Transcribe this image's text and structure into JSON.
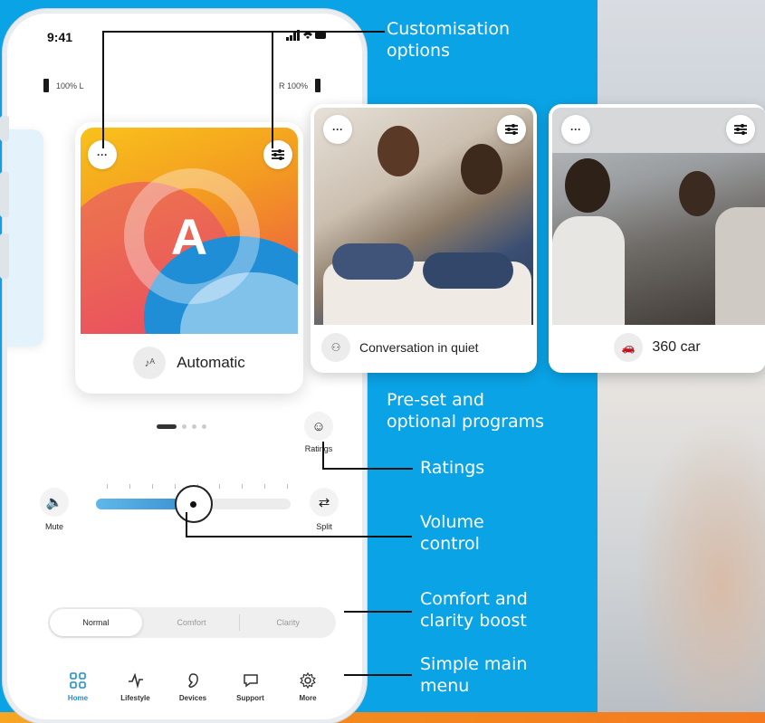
{
  "status": {
    "time": "9:41",
    "icons": "..ıl ≈ ▬"
  },
  "battery": {
    "left": "100% L",
    "right": "R 100%"
  },
  "main_program": {
    "letter": "A",
    "label": "Automatic",
    "more": "···"
  },
  "programs": [
    {
      "label": "Conversation in quiet",
      "more": "···"
    },
    {
      "label": "360 car",
      "more": "···"
    }
  ],
  "controls": {
    "ratings_label": "Ratings",
    "mute_label": "Mute",
    "split_label": "Split",
    "volume_level": 0.5
  },
  "boost": {
    "options": [
      "Normal",
      "Comfort",
      "Clarity"
    ],
    "selected": "Normal"
  },
  "nav": [
    {
      "label": "Home",
      "icon": "home-grid-icon",
      "active": true
    },
    {
      "label": "Lifestyle",
      "icon": "activity-icon",
      "active": false
    },
    {
      "label": "Devices",
      "icon": "hearing-aid-icon",
      "active": false
    },
    {
      "label": "Support",
      "icon": "chat-icon",
      "active": false
    },
    {
      "label": "More",
      "icon": "gear-icon",
      "active": false
    }
  ],
  "annotations": {
    "customisation": [
      "Customisation",
      "options"
    ],
    "programs": [
      "Pre-set and",
      "optional programs"
    ],
    "ratings": [
      "Ratings"
    ],
    "volume": [
      "Volume",
      "control"
    ],
    "boost": [
      "Comfort and",
      "clarity boost"
    ],
    "menu": [
      "Simple main",
      "menu"
    ]
  },
  "colors": {
    "accent": "#1f8ed6",
    "background": "#0aa3e6",
    "stripe": "#f28c1f"
  }
}
